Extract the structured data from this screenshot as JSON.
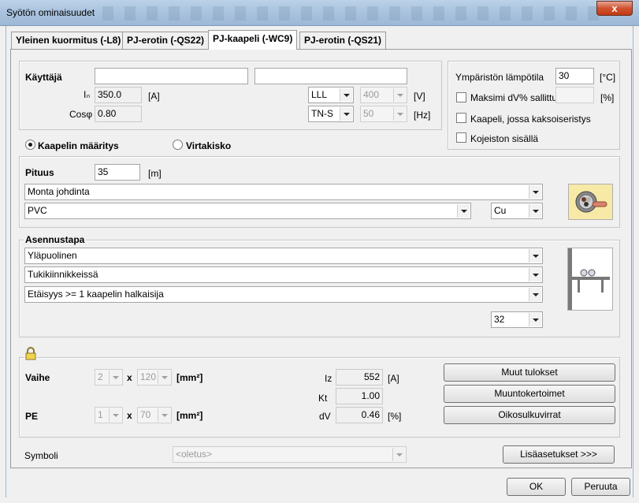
{
  "window": {
    "title": "Syötön ominaisuudet",
    "close": "x"
  },
  "tabs": [
    "Yleinen kuormitus (-L8)",
    "PJ-erotin (-QS22)",
    "PJ-kaapeli (-WC9)",
    "PJ-erotin (-QS21)"
  ],
  "user": {
    "label": "Käyttäjä",
    "field1": "",
    "field2": "",
    "ib_label": "Iₙ",
    "ib_value": "350.0",
    "ib_unit": "[A]",
    "cos_label": "Cosφ",
    "cos_value": "0.80",
    "system": "LLL",
    "voltage": "400",
    "voltage_unit": "[V]",
    "earthing": "TN-S",
    "frequency": "50",
    "frequency_unit": "[Hz]"
  },
  "environment": {
    "temp_label": "Ympäristön lämpötila",
    "temp_value": "30",
    "temp_unit": "[°C]",
    "max_dv_label": "Maksimi dV% sallittu",
    "max_dv_value": "",
    "max_dv_unit": "[%]",
    "double_insulated_label": "Kaapeli, jossa kaksoiseristys",
    "inside_switchgear_label": "Kojeiston sisällä"
  },
  "mode": {
    "cable_label": "Kaapelin määritys",
    "busbar_label": "Virtakisko",
    "selected": "cable"
  },
  "cable": {
    "length_label": "Pituus",
    "length_value": "35",
    "length_unit": "[m]",
    "conductor_type": "Monta johdinta",
    "insulation": "PVC",
    "material": "Cu"
  },
  "installation": {
    "title": "Asennustapa",
    "method": "Yläpuolinen",
    "support": "Tukikiinnikkeissä",
    "spacing": "Etäisyys >= 1 kaapelin halkaisija",
    "temperature_select": "32"
  },
  "sizing": {
    "phase_label": "Vaihe",
    "phase_count": "2",
    "x": "x",
    "phase_size": "120",
    "mm2": "[mm²]",
    "pe_label": "PE",
    "pe_count": "1",
    "pe_size": "70",
    "iz_label": "Iz",
    "iz_value": "552",
    "iz_unit": "[A]",
    "kt_label": "Kt",
    "kt_value": "1.00",
    "dv_label": "dV",
    "dv_value": "0.46",
    "dv_unit": "[%]",
    "btn_results": "Muut tulokset",
    "btn_factors": "Muuntokertoimet",
    "btn_short": "Oikosulkuvirrat"
  },
  "symbol": {
    "label": "Symboli",
    "value": "<oletus>",
    "more": "Lisäasetukset >>>"
  },
  "footer": {
    "ok": "OK",
    "cancel": "Peruuta"
  }
}
